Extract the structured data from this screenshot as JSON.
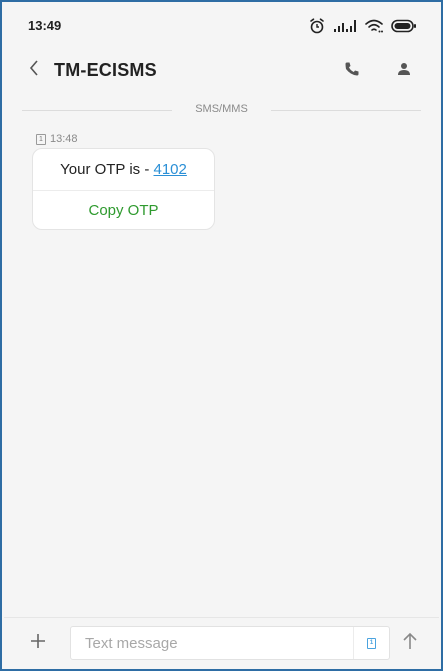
{
  "status_bar": {
    "time": "13:49",
    "icons": [
      "alarm-icon",
      "signal-icon",
      "wifi-icon",
      "battery-icon"
    ]
  },
  "header": {
    "title": "TM-ECISMS",
    "icons": [
      "back-icon",
      "phone-icon",
      "person-icon"
    ]
  },
  "thread": {
    "channel_label": "SMS/MMS",
    "messages": [
      {
        "sim_badge": "1",
        "time": "13:48",
        "text_prefix": "Your OTP is - ",
        "otp": "4102",
        "action_label": "Copy OTP"
      }
    ]
  },
  "composer": {
    "placeholder": "Text message",
    "sim_badge": "1",
    "icons": [
      "plus-icon",
      "sim-icon",
      "send-arrow-icon"
    ]
  },
  "colors": {
    "accent_link": "#2a8fd6",
    "action_green": "#2e9a2e",
    "frame_border": "#2e6da4",
    "background": "#f5f5f5"
  }
}
